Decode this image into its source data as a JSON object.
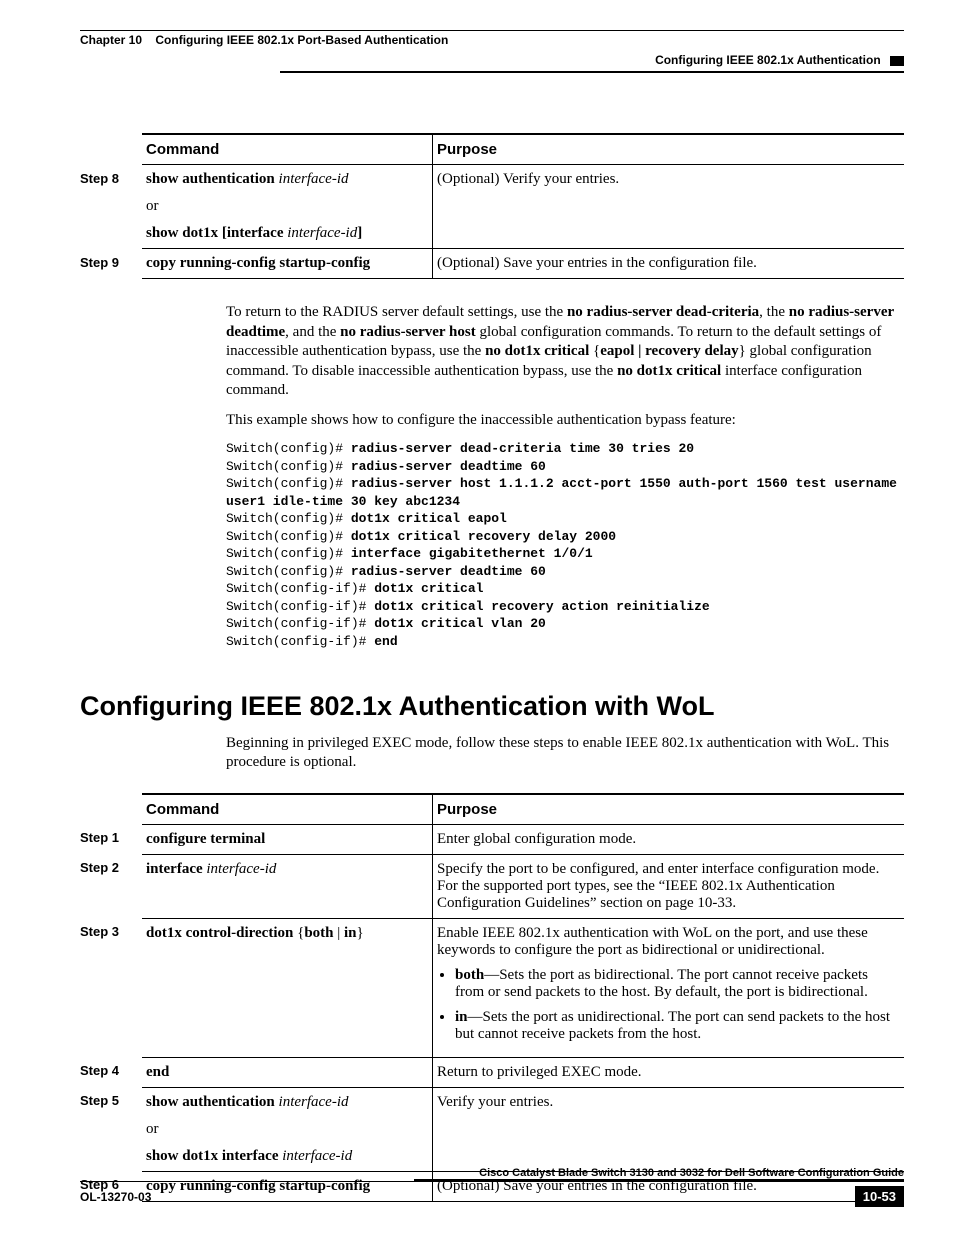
{
  "header": {
    "chapter_label": "Chapter 10",
    "chapter_title": "Configuring IEEE 802.1x Port-Based Authentication",
    "section_title": "Configuring IEEE 802.1x Authentication"
  },
  "table1": {
    "head_command": "Command",
    "head_purpose": "Purpose",
    "rows": [
      {
        "step": "Step 8",
        "cmd_parts": [
          "show authentication ",
          "interface-id"
        ],
        "cmd_or": "or",
        "cmd_parts2_prefix": "show dot1x ",
        "cmd_parts2_bracket_open": "[interface ",
        "cmd_parts2_ital": "interface-id",
        "cmd_parts2_bracket_close": "]",
        "purpose": "(Optional) Verify your entries."
      },
      {
        "step": "Step 9",
        "cmd_single": "copy running-config startup-config",
        "purpose": "(Optional) Save your entries in the configuration file."
      }
    ]
  },
  "para1_a": "To return to the RADIUS server default settings, use the ",
  "para1_b": "no radius-server dead-criteria",
  "para1_c": ", the ",
  "para1_d": "no radius-server deadtime",
  "para1_e": ", and the ",
  "para1_f": "no radius-server host",
  "para1_g": " global configuration commands. To return to the default settings of inaccessible authentication bypass, use the ",
  "para1_h": "no dot1x critical",
  "para1_i": " {",
  "para1_j": "eapol | recovery delay",
  "para1_k": "} global configuration command. To disable inaccessible authentication bypass, use the ",
  "para1_l": "no dot1x critical",
  "para1_m": " interface configuration command.",
  "para2": "This example shows how to configure the inaccessible authentication bypass feature:",
  "code": {
    "l1p": "Switch(config)# ",
    "l1b": "radius-server dead-criteria time 30 tries 20",
    "l2p": "Switch(config)# ",
    "l2b": "radius-server deadtime 60",
    "l3p": "Switch(config)# ",
    "l3b": "radius-server host 1.1.1.2 acct-port 1550 auth-port 1560 test username user1 idle-time 30 key abc1234",
    "l4p": "Switch(config)# ",
    "l4b": "dot1x critical eapol",
    "l5p": "Switch(config)# ",
    "l5b": "dot1x critical recovery delay 2000",
    "l6p": "Switch(config)# ",
    "l6b": "interface gigabitethernet 1/0/1",
    "l7p": "Switch(config)# ",
    "l7b": "radius-server deadtime 60",
    "l8p": "Switch(config-if)# ",
    "l8b": "dot1x critical",
    "l9p": "Switch(config-if)# ",
    "l9b": "dot1x critical recovery action reinitialize",
    "l10p": "Switch(config-if)# ",
    "l10b": "dot1x critical vlan 20",
    "l11p": "Switch(config-if)# ",
    "l11b": "end"
  },
  "h2": "Configuring IEEE 802.1x Authentication with WoL",
  "para3": "Beginning in privileged EXEC mode, follow these steps to enable IEEE 802.1x authentication with WoL. This procedure is optional.",
  "table2": {
    "head_command": "Command",
    "head_purpose": "Purpose",
    "s1": {
      "step": "Step 1",
      "cmd": "configure terminal",
      "purpose": "Enter global configuration mode."
    },
    "s2": {
      "step": "Step 2",
      "cmd_b": "interface ",
      "cmd_i": "interface-id",
      "purpose_a": "Specify the port to be configured, and enter interface configuration mode. For the supported port types, see the ",
      "purpose_link": "“IEEE 802.1x Authentication Configuration Guidelines” section on page 10-33",
      "purpose_c": "."
    },
    "s3": {
      "step": "Step 3",
      "cmd_b1": "dot1x control-direction ",
      "cmd_brace": "{",
      "cmd_b2": "both",
      "cmd_sep": " | ",
      "cmd_b3": "in",
      "cmd_brace2": "}",
      "purpose_lead": "Enable IEEE 802.1x authentication with WoL on the port, and use these keywords to configure the port as bidirectional or unidirectional.",
      "bullet1_b": "both",
      "bullet1_t": "—Sets the port as bidirectional. The port cannot receive packets from or send packets to the host. By default, the port is bidirectional.",
      "bullet2_b": "in",
      "bullet2_t": "—Sets the port as unidirectional. The port can send packets to the host but cannot receive packets from the host."
    },
    "s4": {
      "step": "Step 4",
      "cmd": "end",
      "purpose": "Return to privileged EXEC mode."
    },
    "s5": {
      "step": "Step 5",
      "cmd1_b": "show authentication ",
      "cmd1_i": "interface-id",
      "cmd_or": "or",
      "cmd2_b": "show dot1x interface ",
      "cmd2_i": "interface-id",
      "purpose": "Verify your entries."
    },
    "s6": {
      "step": "Step 6",
      "cmd": "copy running-config startup-config",
      "purpose": "(Optional) Save your entries in the configuration file."
    }
  },
  "footer": {
    "doc_title": "Cisco Catalyst Blade Switch 3130 and 3032 for Dell Software Configuration Guide",
    "doc_number": "OL-13270-03",
    "page_number": "10-53"
  }
}
